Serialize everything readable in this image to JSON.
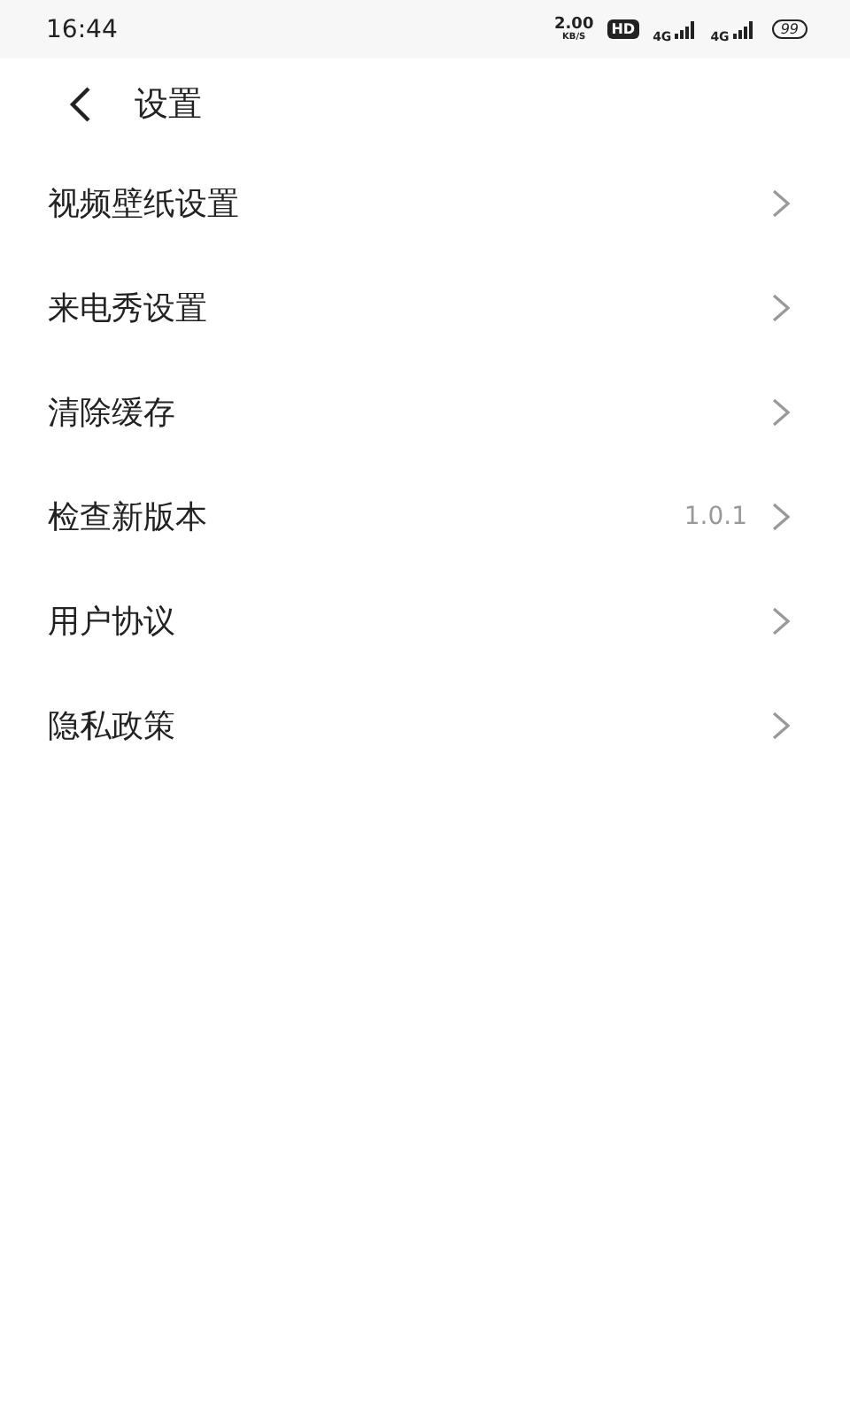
{
  "status_bar": {
    "time": "16:44",
    "speed": "2.00",
    "speed_unit": "KB/S",
    "hd": "HD",
    "network_1": "4G",
    "network_2": "4G",
    "battery": "99"
  },
  "header": {
    "title": "设置"
  },
  "items": [
    {
      "label": "视频壁纸设置"
    },
    {
      "label": "来电秀设置"
    },
    {
      "label": "清除缓存"
    },
    {
      "label": "检查新版本",
      "value": "1.0.1"
    },
    {
      "label": "用户协议"
    },
    {
      "label": "隐私政策"
    }
  ]
}
